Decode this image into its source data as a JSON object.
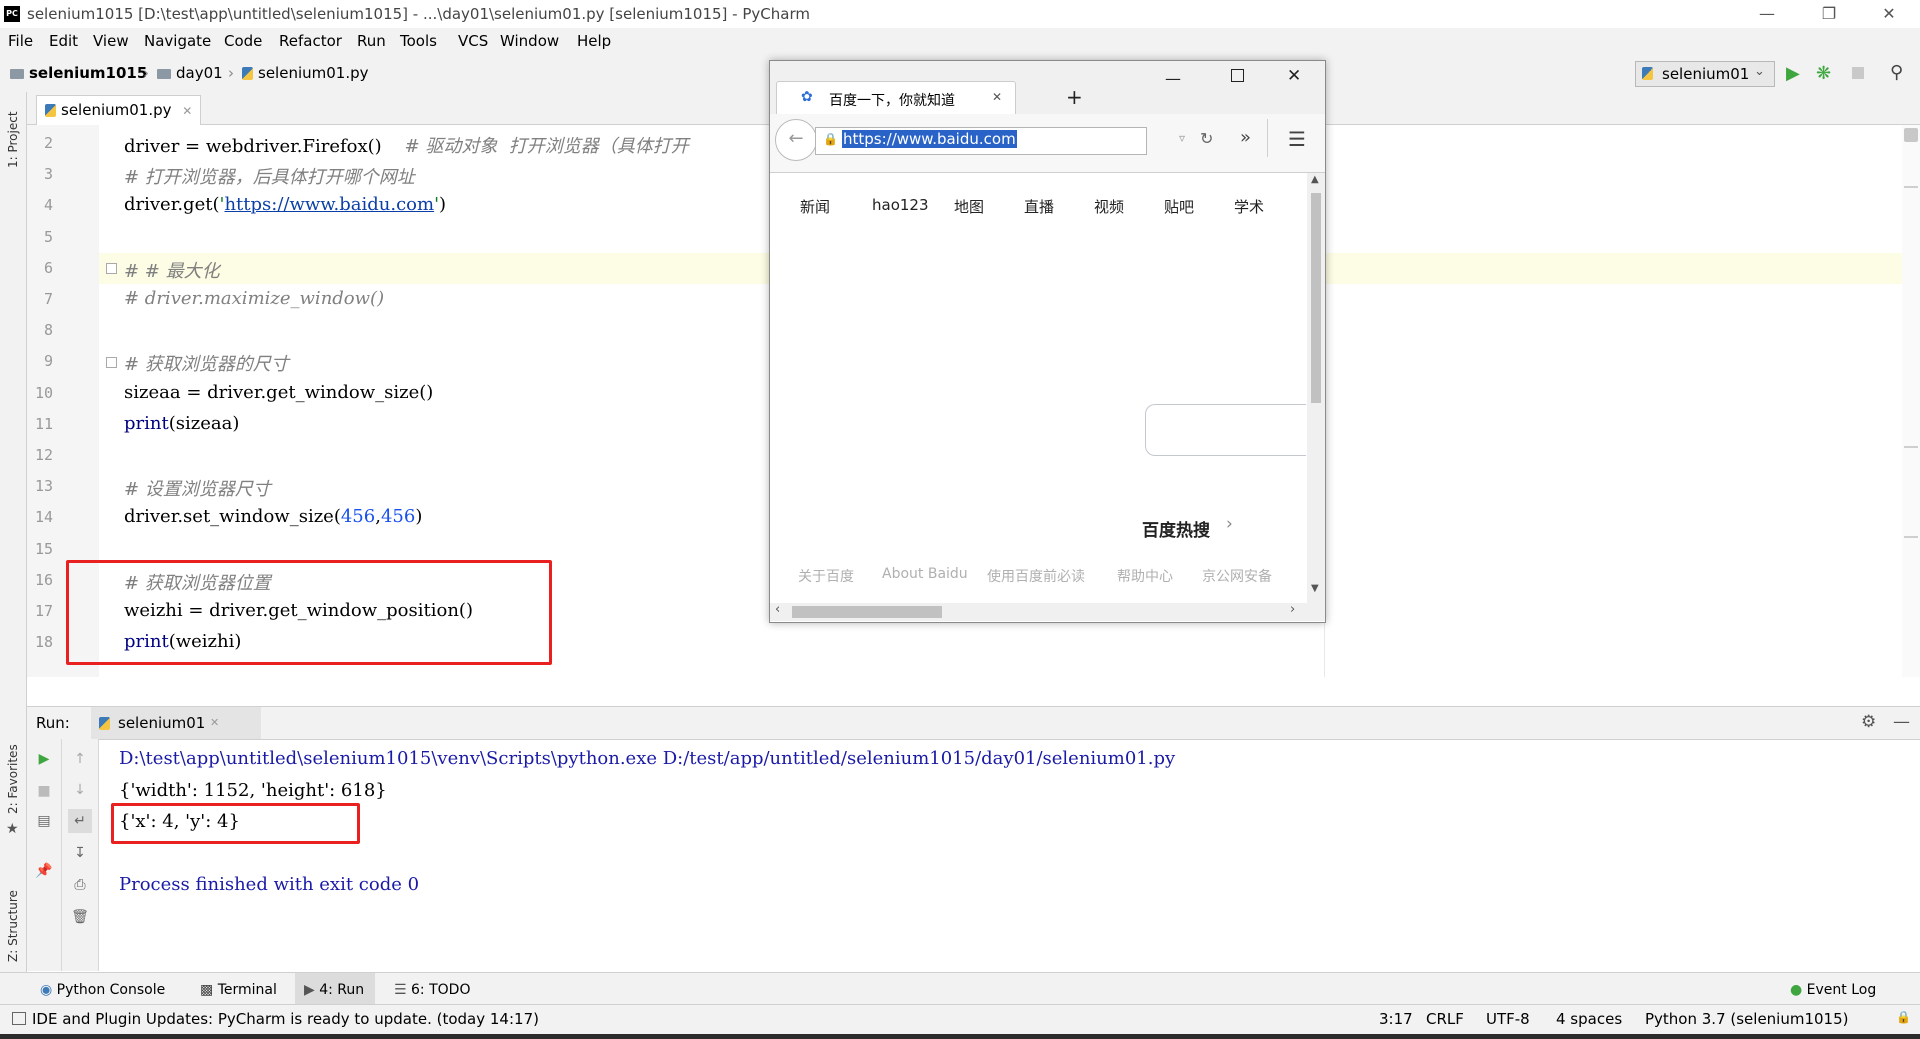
{
  "window": {
    "title": "selenium1015 [D:\\test\\app\\untitled\\selenium1015] - ...\\day01\\selenium01.py [selenium1015] - PyCharm",
    "app_icon": "PC"
  },
  "menu": [
    "File",
    "Edit",
    "View",
    "Navigate",
    "Code",
    "Refactor",
    "Run",
    "Tools",
    "VCS",
    "Window",
    "Help"
  ],
  "breadcrumb": {
    "project": "selenium1015",
    "folder": "day01",
    "file": "selenium01.py"
  },
  "run_config": "selenium01",
  "side_tabs": {
    "project": "1: Project",
    "favorites": "2: Favorites",
    "structure": "Z: Structure"
  },
  "editor": {
    "tab": "selenium01.py",
    "lines": [
      {
        "n": "2",
        "parts": [
          {
            "t": "driver = webdriver.Firefox()    ",
            "c": ""
          },
          {
            "t": "# 驱动对象  打开浏览器（具体打开",
            "c": "cm"
          }
        ]
      },
      {
        "n": "3",
        "parts": [
          {
            "t": "# 打开浏览器，后具体打开哪个网址",
            "c": "cm"
          }
        ]
      },
      {
        "n": "4",
        "parts": [
          {
            "t": "driver.get(",
            "c": ""
          },
          {
            "t": "'",
            "c": "str"
          },
          {
            "t": "https://www.baidu.com",
            "c": "url"
          },
          {
            "t": "'",
            "c": "str"
          },
          {
            "t": ")",
            "c": ""
          }
        ]
      },
      {
        "n": "5",
        "parts": []
      },
      {
        "n": "6",
        "parts": [
          {
            "t": "# # 最大化",
            "c": "cm"
          }
        ]
      },
      {
        "n": "7",
        "parts": [
          {
            "t": "# driver.maximize_window()",
            "c": "cm"
          }
        ]
      },
      {
        "n": "8",
        "parts": []
      },
      {
        "n": "9",
        "parts": [
          {
            "t": "# 获取浏览器的尺寸",
            "c": "cm"
          }
        ]
      },
      {
        "n": "10",
        "parts": [
          {
            "t": "sizeaa = driver.get_window_size()",
            "c": ""
          }
        ]
      },
      {
        "n": "11",
        "parts": [
          {
            "t": "print",
            "c": "bi"
          },
          {
            "t": "(sizeaa)",
            "c": ""
          }
        ]
      },
      {
        "n": "12",
        "parts": []
      },
      {
        "n": "13",
        "parts": [
          {
            "t": "# 设置浏览器尺寸",
            "c": "cm"
          }
        ]
      },
      {
        "n": "14",
        "parts": [
          {
            "t": "driver.set_window_size(",
            "c": ""
          },
          {
            "t": "456",
            "c": "num"
          },
          {
            "t": ",",
            "c": ""
          },
          {
            "t": "456",
            "c": "num"
          },
          {
            "t": ")",
            "c": ""
          }
        ]
      },
      {
        "n": "15",
        "parts": []
      },
      {
        "n": "16",
        "parts": [
          {
            "t": "# 获取浏览器位置",
            "c": "cm"
          }
        ]
      },
      {
        "n": "17",
        "parts": [
          {
            "t": "weizhi = driver.get_window_position()",
            "c": ""
          }
        ]
      },
      {
        "n": "18",
        "parts": [
          {
            "t": "print",
            "c": "bi"
          },
          {
            "t": "(weizhi)",
            "c": ""
          }
        ]
      }
    ]
  },
  "browser": {
    "tab_title": "百度一下，你就知道",
    "url": "https://www.baidu.com",
    "nav": [
      "新闻",
      "hao123",
      "地图",
      "直播",
      "视频",
      "贴吧",
      "学术"
    ],
    "hot": "百度热搜",
    "footer": [
      "关于百度",
      "About Baidu",
      "使用百度前必读",
      "帮助中心",
      "京公网安备"
    ]
  },
  "run": {
    "label": "Run:",
    "tab": "selenium01",
    "output": [
      {
        "t": "D:\\test\\app\\untitled\\selenium1015\\venv\\Scripts\\python.exe D:/test/app/untitled/selenium1015/day01/selenium01.py",
        "c": "#1a1aa6"
      },
      {
        "t": "{'width': 1152, 'height': 618}",
        "c": "#000"
      },
      {
        "t": "{'x': 4, 'y': 4}",
        "c": "#000"
      },
      {
        "t": "",
        "c": "#000"
      },
      {
        "t": "Process finished with exit code 0",
        "c": "#1a1aa6"
      }
    ]
  },
  "tool_windows": {
    "python_console": "Python Console",
    "terminal": "Terminal",
    "run": "4: Run",
    "todo": "6: TODO",
    "event_log": "Event Log"
  },
  "status": {
    "message": "IDE and Plugin Updates: PyCharm is ready to update. (today 14:17)",
    "position": "3:17",
    "line_sep": "CRLF",
    "encoding": "UTF-8",
    "indent": "4 spaces",
    "interpreter": "Python 3.7 (selenium1015)"
  },
  "colors": {
    "accent_red": "#e82020",
    "run_green": "#3fa63f"
  }
}
